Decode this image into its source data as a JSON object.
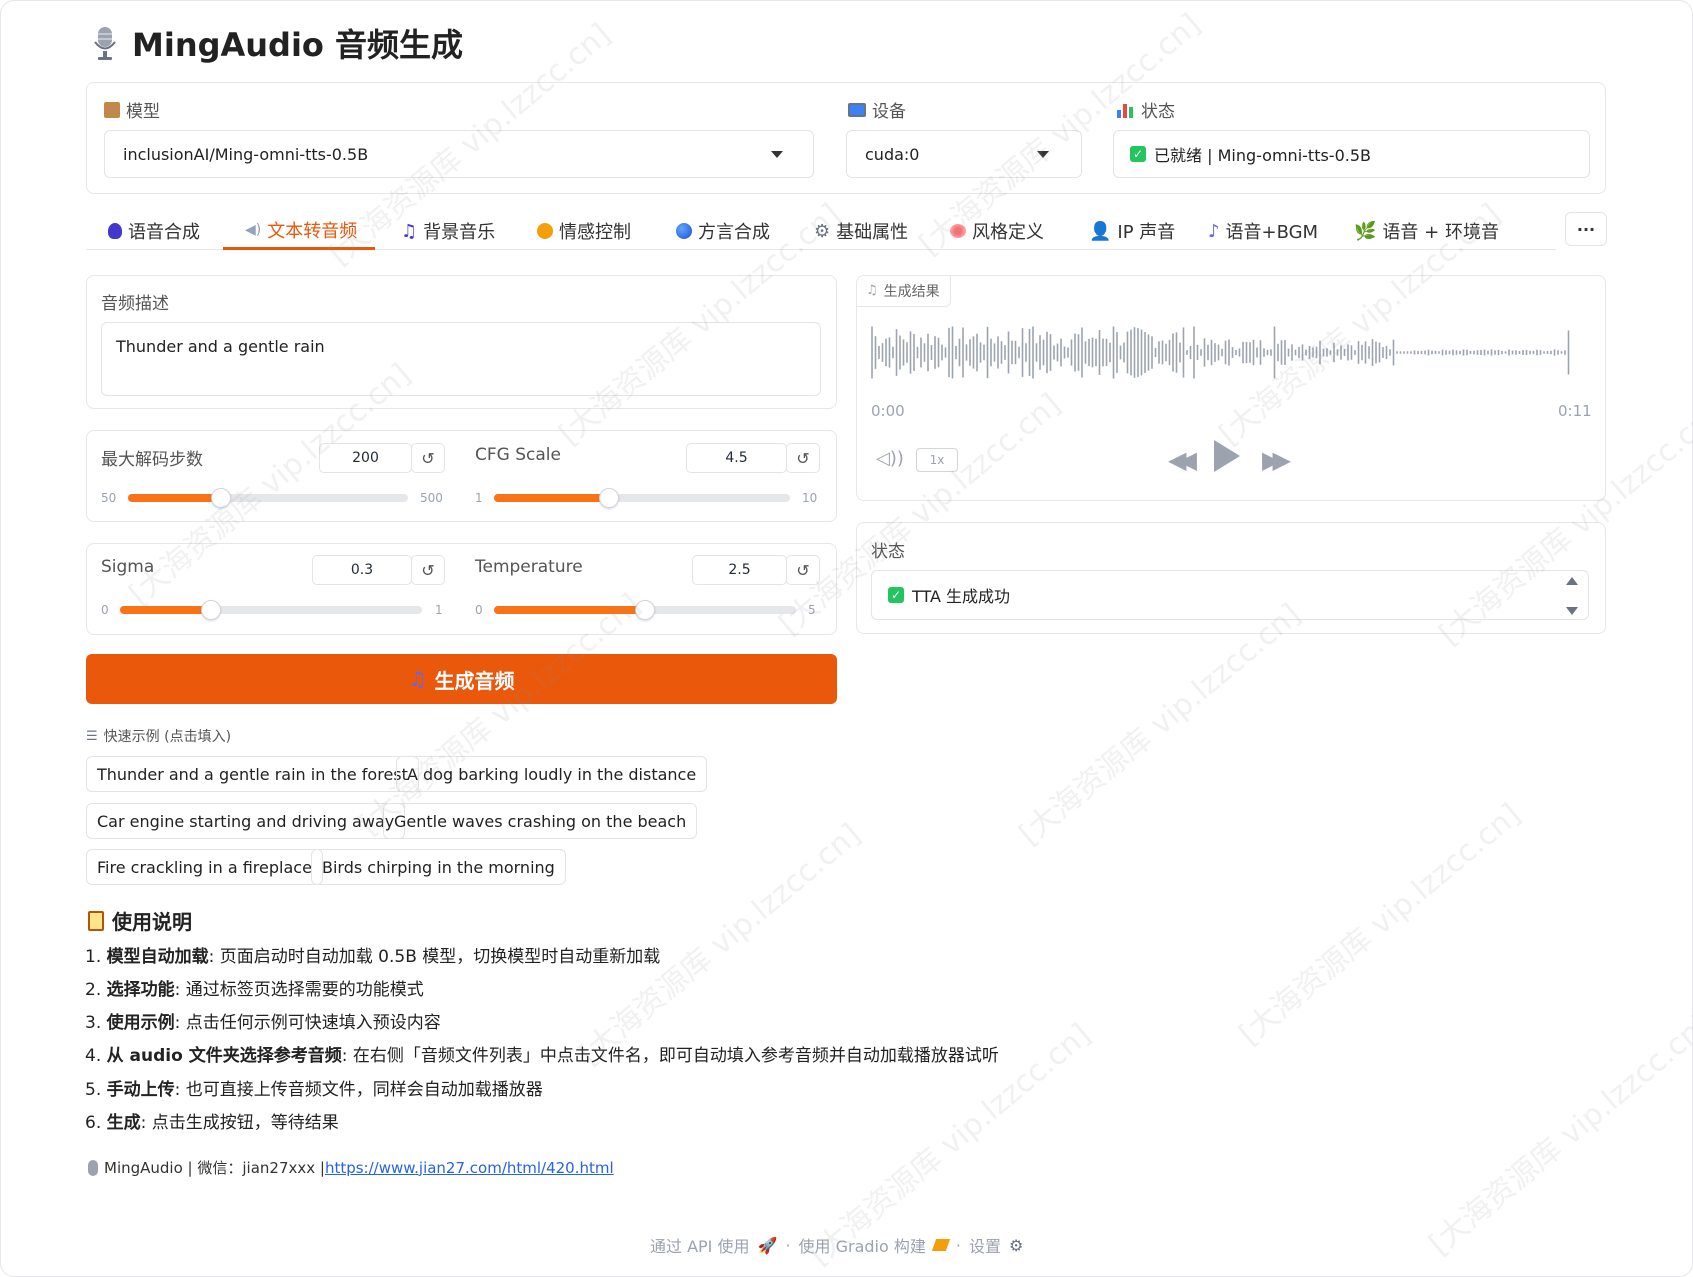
{
  "app": {
    "title": "MingAudio 音频生成",
    "title_icon": "microphone-icon"
  },
  "model": {
    "label": "模型",
    "value": "inclusionAI/Ming-omni-tts-0.5B"
  },
  "device": {
    "label": "设备",
    "value": "cuda:0"
  },
  "status_top": {
    "label": "状态",
    "value": "已就绪 | Ming-omni-tts-0.5B"
  },
  "tabs": [
    {
      "label": "语音合成",
      "icon": "speech-icon"
    },
    {
      "label": "文本转音频",
      "icon": "speaker-icon"
    },
    {
      "label": "背景音乐",
      "icon": "music-note-icon"
    },
    {
      "label": "情感控制",
      "icon": "smile-icon"
    },
    {
      "label": "方言合成",
      "icon": "globe-icon"
    },
    {
      "label": "基础属性",
      "icon": "gear-icon"
    },
    {
      "label": "风格定义",
      "icon": "palette-icon"
    },
    {
      "label": "IP 声音",
      "icon": "person-icon"
    },
    {
      "label": "语音+BGM",
      "icon": "music-speech-icon"
    },
    {
      "label": "语音 + 环境音",
      "icon": "leaf-icon"
    }
  ],
  "tabs_more": "···",
  "description": {
    "label": "音频描述",
    "value": "Thunder and a gentle rain"
  },
  "sliders": {
    "max_steps": {
      "label": "最大解码步数",
      "value": "200",
      "min": "50",
      "max": "500",
      "level": 0.333
    },
    "cfg": {
      "label": "CFG Scale",
      "value": "4.5",
      "min": "1",
      "max": "10",
      "level": 0.389
    },
    "sigma": {
      "label": "Sigma",
      "value": "0.3",
      "min": "0",
      "max": "1",
      "level": 0.3
    },
    "temperature": {
      "label": "Temperature",
      "value": "2.5",
      "min": "0",
      "max": "5",
      "level": 0.5
    }
  },
  "reset_glyph": "↺",
  "generate_button": {
    "label": "生成音频",
    "icon": "music-note-icon"
  },
  "result": {
    "label": "生成结果",
    "time_start": "0:00",
    "time_end": "0:11",
    "speed": "1x"
  },
  "status": {
    "label": "状态",
    "value": "TTA 生成成功"
  },
  "examples": {
    "label": "快速示例 (点击填入)",
    "items": [
      "Thunder and a gentle rain in the forest",
      "A dog barking loudly in the distance",
      "Car engine starting and driving away",
      "Gentle waves crashing on the beach",
      "Fire crackling in a fireplace",
      "Birds chirping in the morning"
    ]
  },
  "instructions": {
    "title": "使用说明",
    "items": [
      {
        "num": "1.",
        "bold": "模型自动加载",
        "text": ": 页面启动时自动加载 0.5B 模型，切换模型时自动重新加载"
      },
      {
        "num": "2.",
        "bold": "选择功能",
        "text": ": 通过标签页选择需要的功能模式"
      },
      {
        "num": "3.",
        "bold": "使用示例",
        "text": ": 点击任何示例可快速填入预设内容"
      },
      {
        "num": "4.",
        "bold": "从 audio 文件夹选择参考音频",
        "text": ": 在右侧「音频文件列表」中点击文件名，即可自动填入参考音频并自动加载播放器试听"
      },
      {
        "num": "5.",
        "bold": "手动上传",
        "text": ": 也可直接上传音频文件，同样会自动加载播放器"
      },
      {
        "num": "6.",
        "bold": "生成",
        "text": ": 点击生成按钮，等待结果"
      }
    ]
  },
  "credit": {
    "prefix": "MingAudio | 微信：jian27xxx | ",
    "link": "https://www.jian27.com/html/420.html"
  },
  "footer": {
    "api": "通过 API 使用",
    "gradio": "使用 Gradio 构建",
    "settings": "设置",
    "sep": "·"
  },
  "watermark": "[大海资源库 vip.lzzcc.cn]",
  "colors": {
    "accent": "#ea580c",
    "fill": "#f97316",
    "success": "#22c55e"
  }
}
